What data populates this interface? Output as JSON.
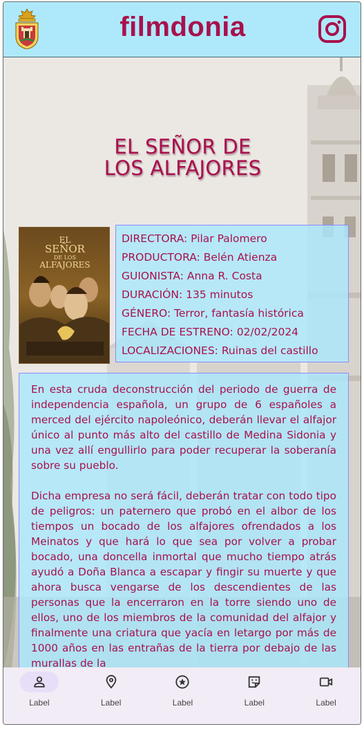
{
  "header": {
    "brand": "filmdonia",
    "crest_icon": "crest-icon",
    "instagram_icon": "instagram-icon"
  },
  "colors": {
    "accent": "#a8114d",
    "appbar_bg": "#aee9fb",
    "panel_bg": "#aae8fc",
    "nav_bg": "#f2ecf6",
    "nav_active": "#e8def8"
  },
  "movie": {
    "title_line1": "EL SEÑOR DE",
    "title_line2": "LOS ALFAJORES",
    "poster": {
      "title_line1": "EL",
      "title_line2": "SEÑOR",
      "title_line3": "DE LOS",
      "title_line4": "ALFAJORES"
    },
    "details": [
      "DIRECTORA: Pilar Palomero",
      "PRODUCTORA: Belén Atienza",
      "GUIONISTA: Anna R. Costa",
      "DURACIÓN: 135 minutos",
      "GÉNERO: Terror, fantasía histórica",
      "FECHA DE ESTRENO: 02/02/2024",
      "LOCALIZACIONES: Ruinas del castillo"
    ],
    "synopsis": [
      "En esta cruda deconstrucción del periodo de guerra de independencia española, un grupo de 6 españoles a merced del ejército napoleónico, deberán llevar el alfajor único al punto más alto del castillo de Medina Sidonia y una vez allí engullirlo para poder recuperar la soberanía sobre su pueblo.",
      "Dicha empresa no será fácil, deberán tratar con todo tipo de peligros: un paternero que probó en el albor de los tiempos un bocado de los alfajores ofrendados a los Meinatos y que hará lo que sea por volver a probar bocado, una doncella inmortal que mucho tiempo atrás ayudó a Doña Blanca a escapar y fingir su muerte y que ahora busca vengarse de los descendientes de las personas que la encerraron en la torre siendo uno de ellos, uno de los miembros de la comunidad del alfajor y finalmente una criatura que yacía en letargo por más de 1000 años en las entrañas de la tierra por debajo de las murallas de la"
    ]
  },
  "nav": {
    "items": [
      {
        "label": "Label",
        "icon": "person-icon",
        "active": true
      },
      {
        "label": "Label",
        "icon": "location-pin-icon",
        "active": false
      },
      {
        "label": "Label",
        "icon": "star-circle-icon",
        "active": false
      },
      {
        "label": "Label",
        "icon": "sticker-icon",
        "active": false
      },
      {
        "label": "Label",
        "icon": "video-camera-icon",
        "active": false
      }
    ]
  }
}
